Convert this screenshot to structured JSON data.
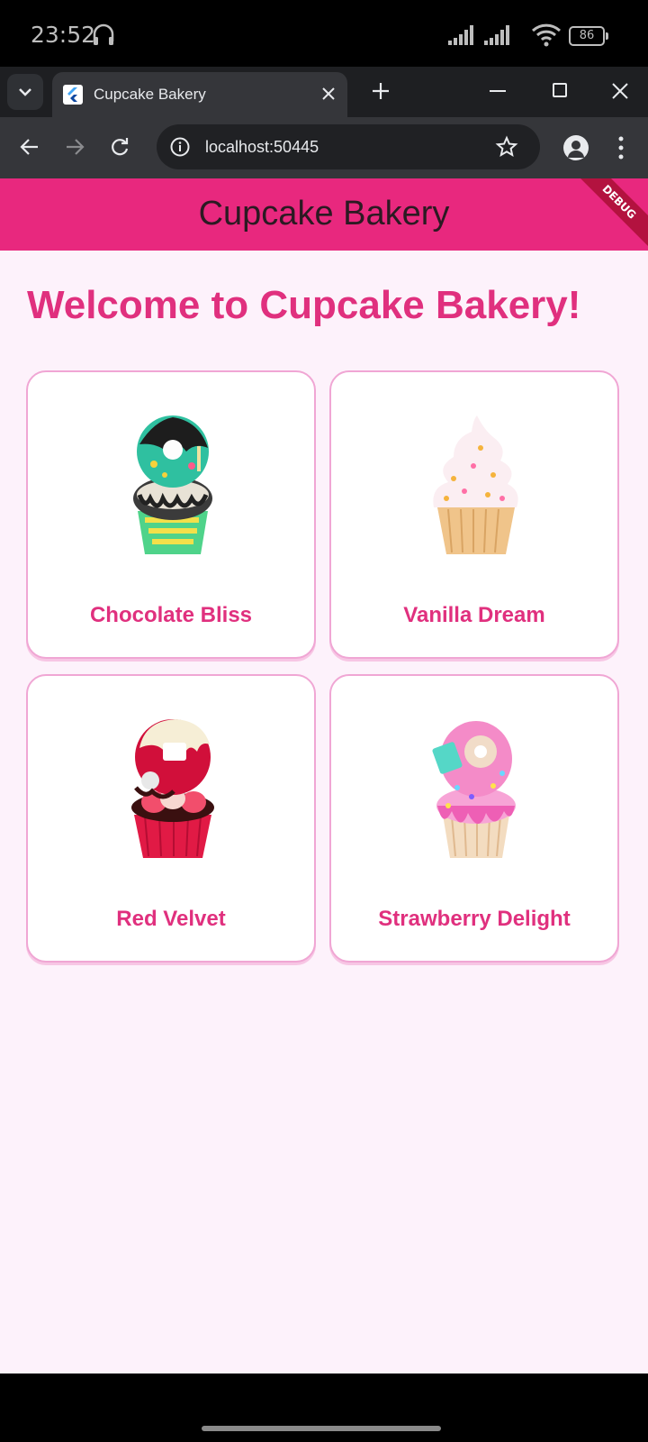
{
  "status_bar": {
    "time": "23:52",
    "battery": "86"
  },
  "browser": {
    "tab_title": "Cupcake Bakery",
    "url": "localhost:50445"
  },
  "app": {
    "title": "Cupcake Bakery",
    "debug_banner": "DEBUG",
    "welcome": "Welcome to Cupcake Bakery!",
    "cupcakes": [
      {
        "name": "Chocolate Bliss"
      },
      {
        "name": "Vanilla Dream"
      },
      {
        "name": "Red Velvet"
      },
      {
        "name": "Strawberry Delight"
      }
    ]
  },
  "colors": {
    "accent": "#e8287e",
    "heading": "#e0307e",
    "page_bg": "#fdf2fb"
  }
}
